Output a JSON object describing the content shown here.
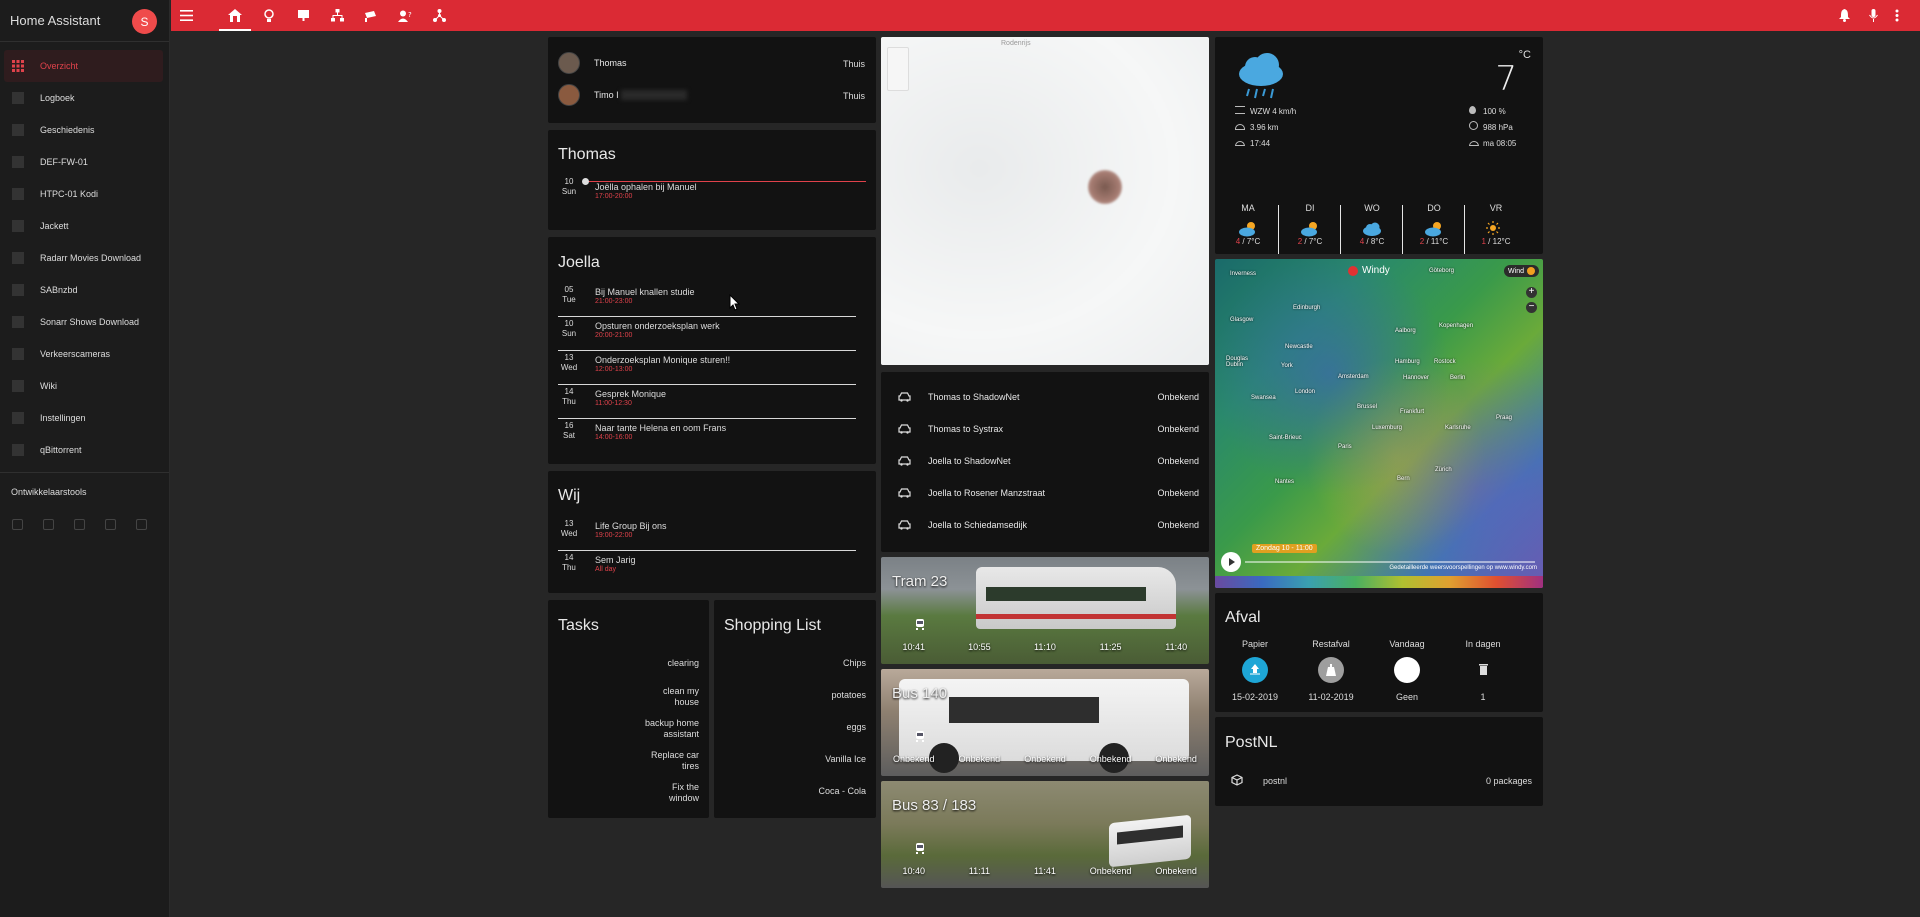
{
  "app": {
    "title": "Home Assistant",
    "avatar_letter": "S",
    "accent": "#db2a34"
  },
  "sidebar": {
    "items": [
      {
        "label": "Overzicht",
        "icon": "grid-icon"
      },
      {
        "label": "Logboek",
        "icon": "list-icon"
      },
      {
        "label": "Geschiedenis",
        "icon": "chart-icon"
      },
      {
        "label": "DEF-FW-01",
        "icon": "server-icon"
      },
      {
        "label": "HTPC-01 Kodi",
        "icon": "kodi-icon"
      },
      {
        "label": "Jackett",
        "icon": "jacket-icon"
      },
      {
        "label": "Radarr Movies Download",
        "icon": "folder-icon"
      },
      {
        "label": "SABnzbd",
        "icon": "download-icon"
      },
      {
        "label": "Sonarr Shows Download",
        "icon": "tv-icon"
      },
      {
        "label": "Verkeerscameras",
        "icon": "camera-icon"
      },
      {
        "label": "Wiki",
        "icon": "wiki-icon"
      },
      {
        "label": "Instellingen",
        "icon": "gear-icon"
      },
      {
        "label": "qBittorrent",
        "icon": "torrent-icon"
      }
    ],
    "dev_tools": "Ontwikkelaarstools"
  },
  "people": [
    {
      "name": "Thomas",
      "state": "Thuis"
    },
    {
      "name": "Timo I",
      "state": "Thuis"
    }
  ],
  "calendars": {
    "thomas": {
      "title": "Thomas",
      "events": [
        {
          "day": "10",
          "dow": "Sun",
          "title": "Joëlla ophalen bij Manuel",
          "time": "17:00-20:00"
        }
      ]
    },
    "joella": {
      "title": "Joella",
      "events": [
        {
          "day": "05",
          "dow": "Tue",
          "title": "Bij Manuel knallen studie",
          "time": "21:00-23:00"
        },
        {
          "day": "10",
          "dow": "Sun",
          "title": "Opsturen onderzoeksplan werk",
          "time": "20:00-21:00"
        },
        {
          "day": "13",
          "dow": "Wed",
          "title": "Onderzoeksplan Monique sturen!!",
          "time": "12:00-13:00"
        },
        {
          "day": "14",
          "dow": "Thu",
          "title": "Gesprek Monique",
          "time": "11:00-12:30"
        },
        {
          "day": "16",
          "dow": "Sat",
          "title": "Naar tante Helena en oom Frans",
          "time": "14:00-16:00"
        }
      ]
    },
    "wij": {
      "title": "Wij",
      "events": [
        {
          "day": "13",
          "dow": "Wed",
          "title": "Life Group Bij ons",
          "time": "19:00-22:00"
        },
        {
          "day": "14",
          "dow": "Thu",
          "title": "Sem Jarig",
          "time": "All day"
        }
      ]
    }
  },
  "tasks": {
    "title": "Tasks",
    "items": [
      "clearing",
      "clean my\nhouse",
      "backup home\nassistant",
      "Replace car\ntires",
      "Fix the\nwindow"
    ]
  },
  "shopping": {
    "title": "Shopping List",
    "items": [
      "Chips",
      "potatoes",
      "eggs",
      "Vanilla Ice",
      "Coca - Cola"
    ]
  },
  "map": {
    "place": "Rodenrijs"
  },
  "travel": [
    {
      "route": "Thomas to ShadowNet",
      "state": "Onbekend"
    },
    {
      "route": "Thomas to Systrax",
      "state": "Onbekend"
    },
    {
      "route": "Joella to ShadowNet",
      "state": "Onbekend"
    },
    {
      "route": "Joella to Rosener Manzstraat",
      "state": "Onbekend"
    },
    {
      "route": "Joella to Schiedamsedijk",
      "state": "Onbekend"
    }
  ],
  "transit": [
    {
      "title": "Tram 23",
      "times": [
        "10:41",
        "10:55",
        "11:10",
        "11:25",
        "11:40"
      ]
    },
    {
      "title": "Bus 140",
      "times": [
        "Onbekend",
        "Onbekend",
        "Onbekend",
        "Onbekend",
        "Onbekend"
      ]
    },
    {
      "title": "Bus 83 / 183",
      "times": [
        "10:40",
        "11:11",
        "11:41",
        "Onbekend",
        "Onbekend"
      ]
    }
  ],
  "weather": {
    "temp": "7",
    "unit": "°C",
    "wind": "WZW 4 km/h",
    "visibility": "3.96 km",
    "sunset": "17:44",
    "humidity": "100 %",
    "pressure": "988 hPa",
    "sunrise": "ma 08:05",
    "forecast": [
      {
        "day": "MA",
        "low": "4",
        "high": "/ 7°C",
        "icon": "partly-cloudy-icon"
      },
      {
        "day": "DI",
        "low": "2",
        "high": "/ 7°C",
        "icon": "partly-cloudy-icon"
      },
      {
        "day": "WO",
        "low": "4",
        "high": "/ 8°C",
        "icon": "cloudy-icon"
      },
      {
        "day": "DO",
        "low": "2",
        "high": "/ 11°C",
        "icon": "partly-cloudy-icon"
      },
      {
        "day": "VR",
        "low": "1",
        "high": "/ 12°C",
        "icon": "sun-icon"
      }
    ]
  },
  "windy": {
    "brand": "Windy",
    "layer": "Wind",
    "time": "Zondag 10 - 11:00",
    "footer": "Gedetailleerde weersvoorspellingen op www.windy.com",
    "cities": [
      "Inverness",
      "Glasgow",
      "Edinburgh",
      "Newcastle",
      "Dublin",
      "London",
      "Paris",
      "Amsterdam",
      "Hannover",
      "Berlin",
      "Brussel",
      "Luxemburg",
      "Kopenhagen",
      "Rostock",
      "Praag",
      "Göteborg",
      "Aalborg",
      "Saint-Brieuc",
      "Nantes",
      "Bern",
      "Zürich",
      "Karlsruhe",
      "Swansea",
      "Douglas",
      "York",
      "Hamburg",
      "Frankfurt"
    ]
  },
  "afval": {
    "title": "Afval",
    "cols": [
      {
        "label": "Papier",
        "value": "15-02-2019",
        "color": "#1ea6d6"
      },
      {
        "label": "Restafval",
        "value": "11-02-2019",
        "color": "#9e9e9e"
      },
      {
        "label": "Vandaag",
        "value": "Geen",
        "color": "#ffffff"
      },
      {
        "label": "In dagen",
        "value": "1",
        "color": ""
      }
    ]
  },
  "postnl": {
    "title": "PostNL",
    "name": "postnl",
    "value": "0 packages"
  }
}
